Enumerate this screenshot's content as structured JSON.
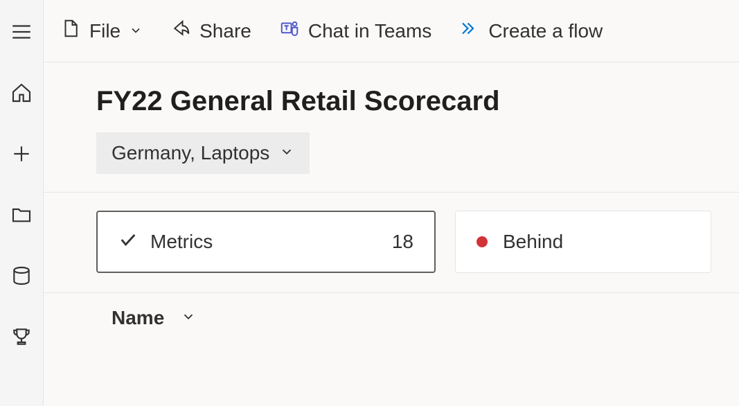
{
  "toolbar": {
    "file_label": "File",
    "share_label": "Share",
    "chat_label": "Chat in Teams",
    "flow_label": "Create a flow"
  },
  "page": {
    "title": "FY22 General Retail Scorecard",
    "filter_label": "Germany, Laptops"
  },
  "cards": {
    "metrics_label": "Metrics",
    "metrics_value": "18",
    "behind_label": "Behind"
  },
  "columns": {
    "name_label": "Name"
  }
}
